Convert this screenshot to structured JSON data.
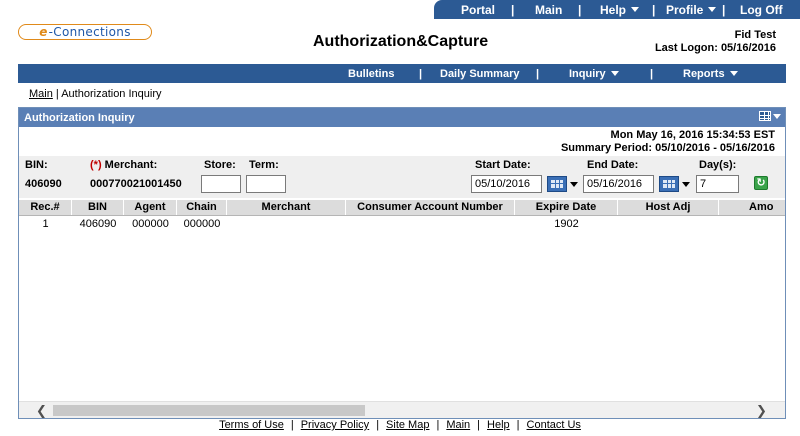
{
  "topnav": {
    "portal": "Portal",
    "main": "Main",
    "help": "Help",
    "profile": "Profile",
    "logoff": "Log Off",
    "separator": "|"
  },
  "logo": {
    "e": "e",
    "rest": "-Connections"
  },
  "header": {
    "title": "Authorization&Capture",
    "user_name": "Fid Test",
    "last_logon": "Last Logon: 05/16/2016"
  },
  "subnav": {
    "bulletins": "Bulletins",
    "daily_summary": "Daily Summary",
    "inquiry": "Inquiry",
    "reports": "Reports",
    "separator": "|"
  },
  "breadcrumb": {
    "main": "Main",
    "separator": " | ",
    "current": "Authorization Inquiry"
  },
  "panel": {
    "title": "Authorization Inquiry",
    "datetime": "Mon May 16, 2016 15:34:53 EST",
    "summary_period": "Summary Period: 05/10/2016 - 05/16/2016"
  },
  "filters": {
    "bin_label": "BIN:",
    "bin_value": "406090",
    "required_marker": "(*)",
    "merchant_label": " Merchant:",
    "merchant_value": "000770021001450",
    "store_label": "Store:",
    "store_value": "",
    "term_label": "Term:",
    "term_value": "",
    "start_date_label": "Start Date:",
    "start_date_value": "05/10/2016",
    "end_date_label": "End Date:",
    "end_date_value": "05/16/2016",
    "days_label": "Day(s):",
    "days_value": "7"
  },
  "table": {
    "columns": [
      "Rec.#",
      "BIN",
      "Agent",
      "Chain",
      "Merchant",
      "Consumer Account Number",
      "Expire Date",
      "Host Adj",
      "Amo"
    ],
    "rows": [
      [
        "1",
        "406090",
        "000000",
        "000000",
        "",
        "",
        "1902",
        "",
        ""
      ]
    ]
  },
  "footer": {
    "links": [
      "Terms of Use",
      "Privacy Policy",
      "Site Map",
      "Main",
      "Help",
      "Contact Us"
    ],
    "separator": "|"
  },
  "colors": {
    "nav_blue": "#2c5a94",
    "panel_header": "#5a7fb5",
    "logo_orange": "#e08a1a",
    "required_red": "#c00000"
  },
  "icons": [
    "calendar-icon",
    "refresh-icon",
    "grid-menu-icon",
    "chevron-left-icon",
    "chevron-right-icon",
    "dropdown-caret-icon"
  ]
}
